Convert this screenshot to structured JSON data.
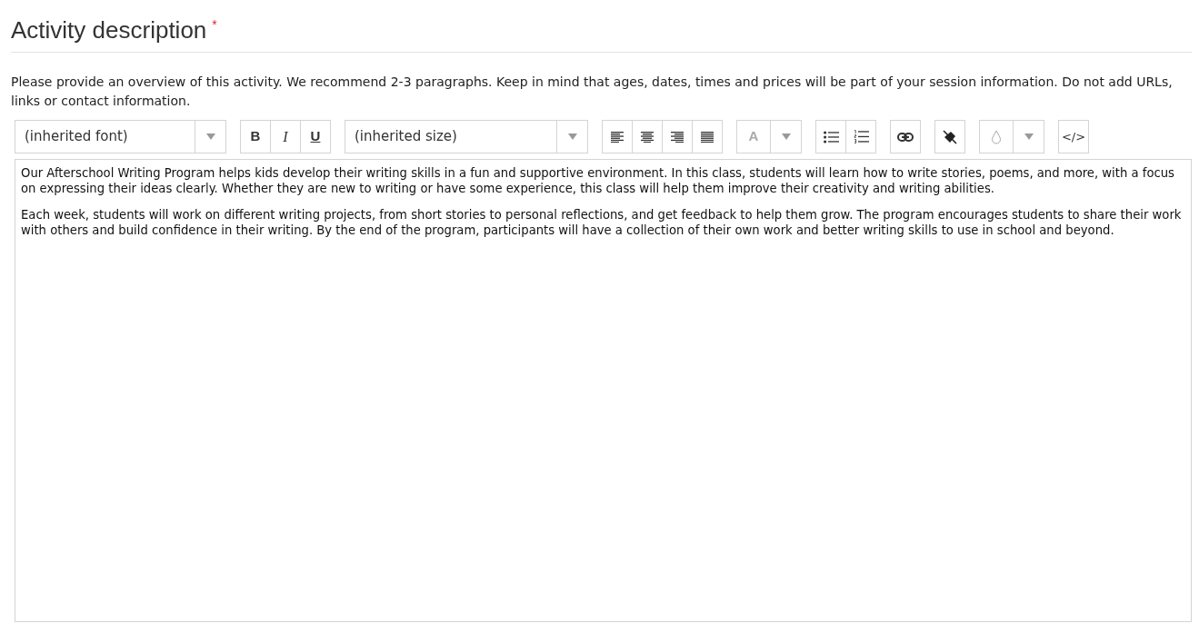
{
  "heading": {
    "title": "Activity description",
    "required_mark": "*"
  },
  "help_text": "Please provide an overview of this activity. We recommend 2-3 paragraphs. Keep in mind that ages, dates, times and prices will be part of your session information. Do not add URLs, links or contact information.",
  "toolbar": {
    "font_select": "(inherited font)",
    "bold": "B",
    "italic": "I",
    "underline": "U",
    "size_select": "(inherited size)",
    "font_color": "A",
    "code_view": "</>"
  },
  "editor": {
    "paragraphs": [
      "Our Afterschool Writing Program helps kids develop their writing skills in a fun and supportive environment. In this class, students will learn how to write stories, poems, and more, with a focus on expressing their ideas clearly. Whether they are new to writing or have some experience, this class will help them improve their creativity and writing abilities.",
      "Each week, students will work on different writing projects, from short stories to personal reflections, and get feedback to help them grow. The program encourages students to share their work with others and build confidence in their writing. By the end of the program, participants will have a collection of their own work and better writing skills to use in school and beyond."
    ]
  }
}
